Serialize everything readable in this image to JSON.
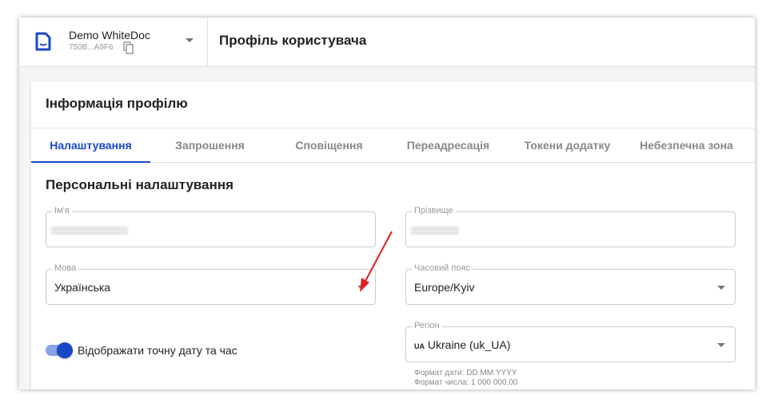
{
  "workspace": {
    "name": "Demo WhiteDoc",
    "id": "750B...A9F6"
  },
  "page_title": "Профіль користувача",
  "card_title": "Інформація профілю",
  "tabs": [
    "Налаштування",
    "Запрошення",
    "Сповіщення",
    "Переадресація",
    "Токени додатку",
    "Небезпечна зона"
  ],
  "section_title": "Персональні налаштування",
  "fields": {
    "first_name": {
      "label": "Ім'я"
    },
    "last_name": {
      "label": "Прізвище"
    },
    "language": {
      "label": "Мова",
      "value": "Українська"
    },
    "timezone": {
      "label": "Часовий пояс",
      "value": "Europe/Kyiv"
    },
    "region": {
      "label": "Регіон",
      "flag": "UA",
      "value": "Ukraine (uk_UA)"
    }
  },
  "date_format": "Формат дати: DD.MM.YYYY",
  "number_format": "Формат числа: 1 000 000,00",
  "toggle": {
    "label": "Відображати точну дату та час",
    "on": true
  },
  "colors": {
    "accent": "#1a47c8",
    "annotation": "#e02020"
  }
}
